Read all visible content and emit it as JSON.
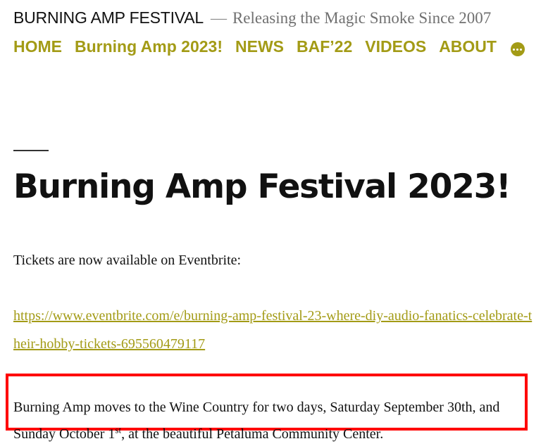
{
  "header": {
    "site_title": "BURNING AMP FESTIVAL",
    "separator": "—",
    "description": "Releasing the Magic Smoke Since 2007"
  },
  "nav": {
    "items": [
      {
        "label": "HOME"
      },
      {
        "label": "Burning Amp 2023!"
      },
      {
        "label": "NEWS"
      },
      {
        "label": "BAF’22"
      },
      {
        "label": "VIDEOS"
      },
      {
        "label": "ABOUT"
      }
    ],
    "more_icon": "ellipsis-icon"
  },
  "colors": {
    "accent": "#a39b16",
    "text": "#111111",
    "highlight_border": "#ff0000"
  },
  "entry": {
    "title": "Burning Amp Festival 2023!",
    "tickets_text": "Tickets are now available on Eventbrite:",
    "ticket_link": "https://www.eventbrite.com/e/burning-amp-festival-23-where-diy-audio-fanatics-celebrate-their-hobby-tickets-695560479117",
    "venue_text_1": "Burning Amp moves to the Wine Country for two days, Saturday September 30th, and Sunday October 1",
    "venue_sup": "st",
    "venue_text_2": ", at the beautiful Petaluma Community Center."
  }
}
